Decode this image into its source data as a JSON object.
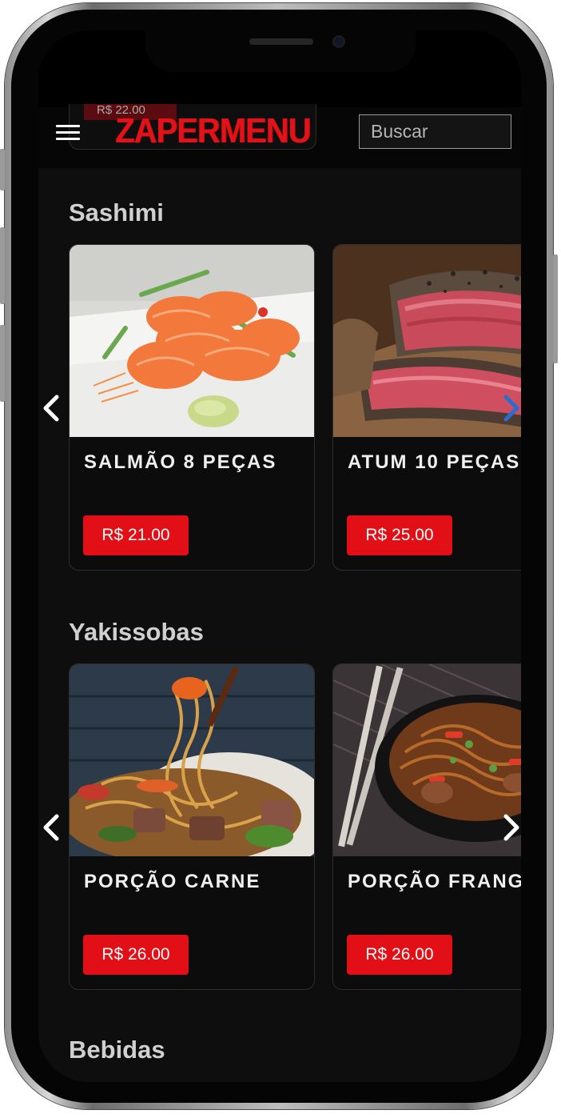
{
  "header": {
    "peek_price": "R$ 22.00",
    "logo": "ZAPERMENU",
    "search_placeholder": "Buscar"
  },
  "sections": [
    {
      "title": "Sashimi",
      "items": [
        {
          "name": "SALMÃO 8 PEÇAS",
          "price": "R$ 21.00"
        },
        {
          "name": "ATUM 10 PEÇAS",
          "price": "R$ 25.00"
        }
      ]
    },
    {
      "title": "Yakissobas",
      "items": [
        {
          "name": "PORÇÃO CARNE",
          "price": "R$ 26.00"
        },
        {
          "name": "PORÇÃO FRANGO",
          "price": "R$ 26.00"
        }
      ]
    },
    {
      "title": "Bebidas"
    }
  ],
  "icons": {
    "menu": "hamburger-icon",
    "prev": "chevron-left-icon",
    "next": "chevron-right-icon"
  },
  "colors": {
    "accent": "#e30f17",
    "background": "#0e0e0e",
    "next_arrow_sashimi": "#2b6cd1"
  }
}
